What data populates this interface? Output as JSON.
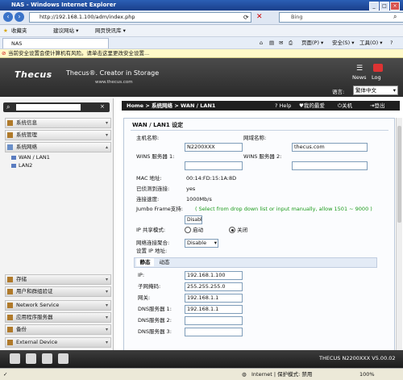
{
  "browser": {
    "title": "NAS - Windows Internet Explorer",
    "address": "http://192.168.1.100/adm/index.php",
    "search_placeholder": "Bing",
    "favorites": "收藏夹",
    "fav_items": [
      "建议网站 ▾",
      "网页快讯库 ▾"
    ],
    "tab_title": "NAS",
    "tools": [
      "页面(P) ▾",
      "安全(S) ▾",
      "工具(O) ▾"
    ],
    "infobar": "当前安全设置会使计算机有风险。请单击这里更改安全设置...",
    "status_zone": "Internet | 保护模式: 禁用",
    "zoom": "100%"
  },
  "header": {
    "logo": "Thecus",
    "slogan": "Thecus®. Creator in Storage",
    "site": "www.thecus.com",
    "news": "News",
    "log": "Log",
    "lang_label": "语言:",
    "lang_value": "繁体中文"
  },
  "menu": {
    "categories_top": [
      "系统信息",
      "系统管理",
      "系统网络"
    ],
    "sub_items": [
      "WAN / LAN1",
      "LAN2"
    ],
    "categories_bottom": [
      "存储",
      "用户和群组验证",
      "Network Service",
      "应用程序服务器",
      "备份",
      "External Device"
    ]
  },
  "topbar": {
    "breadcrumb": "Home > 系统网络 > WAN / LAN1",
    "help": "Help",
    "favorite": "我的最爱",
    "shutdown": "关机",
    "logout": "登出"
  },
  "form": {
    "title": "WAN / LAN1 设定",
    "host_label": "主机名称:",
    "host_value": "N2200XXX",
    "domain_label": "网域名称:",
    "domain_value": "thecus.com",
    "wins1_label": "WINS 服务器 1:",
    "wins2_label": "WINS 服务器 2:",
    "mac_label": "MAC 地址:",
    "mac_value": "00:14:FD:15:1A:8D",
    "link_label": "已侦测到连接:",
    "link_value": "yes",
    "speed_label": "连接速度:",
    "speed_value": "1000Mb/s",
    "jumbo_label": "Jumbo Frame支持:",
    "jumbo_hint": "( Select from drop down list or input manually, allow 1501 ~ 9000 )",
    "jumbo_value": "Disabl",
    "ipshare_label": "IP 共享模式:",
    "ipshare_on": "启动",
    "ipshare_off": "关闭",
    "agg_label": "网络连接聚合:",
    "agg_value": "Disable",
    "ipset_label": "设置 IP 地址:",
    "tab_static": "静态",
    "tab_dynamic": "动态",
    "ip_label": "IP:",
    "ip_value": "192.168.1.100",
    "mask_label": "子网掩码:",
    "mask_value": "255.255.255.0",
    "gw_label": "网关:",
    "gw_value": "192.168.1.1",
    "dns1_label": "DNS服务器 1:",
    "dns1_value": "192.168.1.1",
    "dns2_label": "DNS服务器 2:",
    "dns3_label": "DNS服务器 3:"
  },
  "footer": {
    "version": "THECUS N2200XXX V5.00.02"
  }
}
